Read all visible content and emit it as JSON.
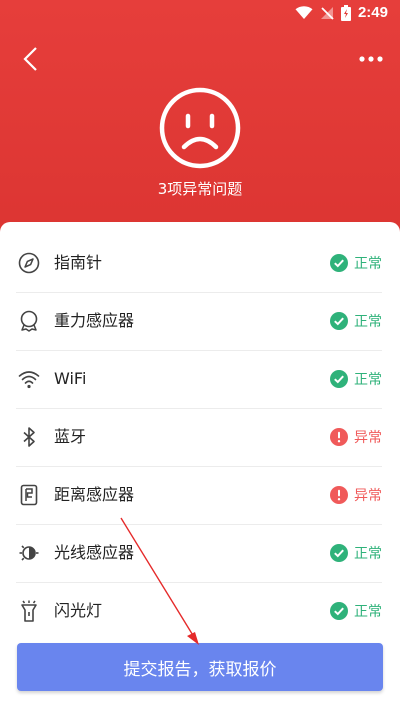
{
  "statusbar": {
    "time": "2:49"
  },
  "header": {
    "summary": "3项异常问题"
  },
  "colors": {
    "header_red": "#e03a37",
    "ok_green": "#2fb27a",
    "error_red": "#f05a5a",
    "button_blue": "#6985ee"
  },
  "items": [
    {
      "label": "指南针",
      "icon": "compass-icon",
      "status": "正常",
      "ok": true
    },
    {
      "label": "重力感应器",
      "icon": "gravity-sensor-icon",
      "status": "正常",
      "ok": true
    },
    {
      "label": "WiFi",
      "icon": "wifi-icon",
      "status": "正常",
      "ok": true
    },
    {
      "label": "蓝牙",
      "icon": "bluetooth-icon",
      "status": "异常",
      "ok": false
    },
    {
      "label": "距离感应器",
      "icon": "proximity-sensor-icon",
      "status": "异常",
      "ok": false
    },
    {
      "label": "光线感应器",
      "icon": "light-sensor-icon",
      "status": "正常",
      "ok": true
    },
    {
      "label": "闪光灯",
      "icon": "flashlight-icon",
      "status": "正常",
      "ok": true
    }
  ],
  "submit_label": "提交报告，获取报价"
}
